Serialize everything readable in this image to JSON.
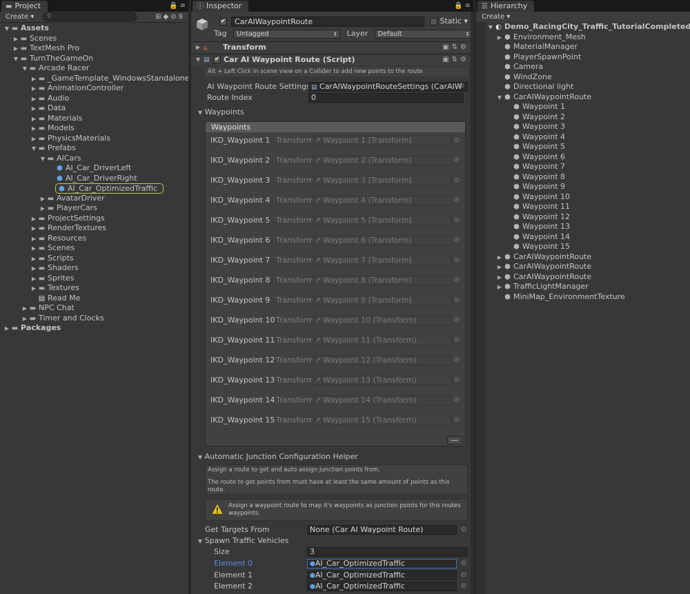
{
  "project": {
    "tab_label": "Project",
    "create_label": "Create",
    "hidden_count": "9",
    "tree": [
      {
        "label": "Assets",
        "depth": 0,
        "arrow": "▼",
        "icon": "folder",
        "bold": true
      },
      {
        "label": "Scenes",
        "depth": 1,
        "arrow": "▶",
        "icon": "folder"
      },
      {
        "label": "TextMesh Pro",
        "depth": 1,
        "arrow": "▶",
        "icon": "folder"
      },
      {
        "label": "TurnTheGameOn",
        "depth": 1,
        "arrow": "▼",
        "icon": "folder"
      },
      {
        "label": "Arcade Racer",
        "depth": 2,
        "arrow": "▼",
        "icon": "folder"
      },
      {
        "label": "_GameTemplate_WindowsStandalone",
        "depth": 3,
        "arrow": "▶",
        "icon": "folder"
      },
      {
        "label": "AnimationController",
        "depth": 3,
        "arrow": "▶",
        "icon": "folder"
      },
      {
        "label": "Audio",
        "depth": 3,
        "arrow": "▶",
        "icon": "folder"
      },
      {
        "label": "Data",
        "depth": 3,
        "arrow": "▶",
        "icon": "folder"
      },
      {
        "label": "Materials",
        "depth": 3,
        "arrow": "▶",
        "icon": "folder"
      },
      {
        "label": "Models",
        "depth": 3,
        "arrow": "▶",
        "icon": "folder"
      },
      {
        "label": "PhysicsMaterials",
        "depth": 3,
        "arrow": "▶",
        "icon": "folder"
      },
      {
        "label": "Prefabs",
        "depth": 3,
        "arrow": "▼",
        "icon": "folder"
      },
      {
        "label": "AICars",
        "depth": 4,
        "arrow": "▼",
        "icon": "folder"
      },
      {
        "label": "AI_Car_DriverLeft",
        "depth": 5,
        "arrow": "",
        "icon": "prefab"
      },
      {
        "label": "AI_Car_DriverRight",
        "depth": 5,
        "arrow": "",
        "icon": "prefab"
      },
      {
        "label": "AI_Car_OptimizedTraffic",
        "depth": 5,
        "arrow": "",
        "icon": "prefab",
        "highlight": true
      },
      {
        "label": "AvatarDriver",
        "depth": 4,
        "arrow": "▶",
        "icon": "folder"
      },
      {
        "label": "PlayerCars",
        "depth": 4,
        "arrow": "▶",
        "icon": "folder"
      },
      {
        "label": "ProjectSettings",
        "depth": 3,
        "arrow": "▶",
        "icon": "folder"
      },
      {
        "label": "RenderTextures",
        "depth": 3,
        "arrow": "▶",
        "icon": "folder"
      },
      {
        "label": "Resources",
        "depth": 3,
        "arrow": "▶",
        "icon": "folder"
      },
      {
        "label": "Scenes",
        "depth": 3,
        "arrow": "▶",
        "icon": "folder"
      },
      {
        "label": "Scripts",
        "depth": 3,
        "arrow": "▶",
        "icon": "folder"
      },
      {
        "label": "Shaders",
        "depth": 3,
        "arrow": "▶",
        "icon": "folder"
      },
      {
        "label": "Sprites",
        "depth": 3,
        "arrow": "▶",
        "icon": "folder"
      },
      {
        "label": "Textures",
        "depth": 3,
        "arrow": "▶",
        "icon": "folder"
      },
      {
        "label": "Read Me",
        "depth": 3,
        "arrow": "",
        "icon": "doc"
      },
      {
        "label": "NPC Chat",
        "depth": 2,
        "arrow": "▶",
        "icon": "folder"
      },
      {
        "label": "Timer and Clocks",
        "depth": 2,
        "arrow": "▶",
        "icon": "folder"
      },
      {
        "label": "Packages",
        "depth": 0,
        "arrow": "▶",
        "icon": "folder",
        "bold": true
      }
    ]
  },
  "inspector": {
    "tab_label": "Inspector",
    "object_name": "CarAIWaypointRoute",
    "static_label": "Static",
    "tag_label": "Tag",
    "tag_value": "Untagged",
    "layer_label": "Layer",
    "layer_value": "Default",
    "transform_label": "Transform",
    "script_label": "Car AI Waypoint Route (Script)",
    "hint_text": "Alt + Left Click in scene view on a Collider to add new points to the route",
    "settings_label": "AI Waypoint Route Settings",
    "settings_value": "CarAIWaypointRouteSettings (CarAIW",
    "route_index_label": "Route Index",
    "route_index_value": "0",
    "waypoints_foldout": "Waypoints",
    "waypoints_header": "Waypoints",
    "type_label": "Transform",
    "waypoints": [
      {
        "label": "IKD_Waypoint 1",
        "value": "Waypoint 1 (Transform)"
      },
      {
        "label": "IKD_Waypoint 2",
        "value": "Waypoint 2 (Transform)"
      },
      {
        "label": "IKD_Waypoint 3",
        "value": "Waypoint 3 (Transform)"
      },
      {
        "label": "IKD_Waypoint 4",
        "value": "Waypoint 4 (Transform)"
      },
      {
        "label": "IKD_Waypoint 5",
        "value": "Waypoint 5 (Transform)"
      },
      {
        "label": "IKD_Waypoint 6",
        "value": "Waypoint 6 (Transform)"
      },
      {
        "label": "IKD_Waypoint 7",
        "value": "Waypoint 7 (Transform)"
      },
      {
        "label": "IKD_Waypoint 8",
        "value": "Waypoint 8 (Transform)"
      },
      {
        "label": "IKD_Waypoint 9",
        "value": "Waypoint 9 (Transform)"
      },
      {
        "label": "IKD_Waypoint 10",
        "value": "Waypoint 10 (Transform)"
      },
      {
        "label": "IKD_Waypoint 11",
        "value": "Waypoint 11 (Transform)"
      },
      {
        "label": "IKD_Waypoint 12",
        "value": "Waypoint 12 (Transform)"
      },
      {
        "label": "IKD_Waypoint 13",
        "value": "Waypoint 13 (Transform)"
      },
      {
        "label": "IKD_Waypoint 14",
        "value": "Waypoint 14 (Transform)"
      },
      {
        "label": "IKD_Waypoint 15",
        "value": "Waypoint 15 (Transform)"
      }
    ],
    "minus_label": "—",
    "junction_foldout": "Automatic Junction Configuration Helper",
    "junction_help_1": "Assign a route to get and auto assign junction points from.",
    "junction_help_2": "The route to get points from must have at least the same amount of points as this route.",
    "warning_text": "Assign a waypoint route to map it's waypoints as junction points for this routes waypoints.",
    "get_targets_label": "Get Targets From",
    "get_targets_value": "None (Car AI Waypoint Route)",
    "spawn_foldout": "Spawn Traffic Vehicles",
    "size_label": "Size",
    "size_value": "3",
    "elements": [
      {
        "label": "Element 0",
        "value": "AI_Car_OptimizedTraffic"
      },
      {
        "label": "Element 1",
        "value": "AI_Car_OptimizedTraffic"
      },
      {
        "label": "Element 2",
        "value": "AI_Car_OptimizedTraffic"
      }
    ]
  },
  "hierarchy": {
    "tab_label": "Hierarchy",
    "create_label": "Create",
    "tree": [
      {
        "label": "Demo_RacingCity_Traffic_TutorialCompleted",
        "depth": 0,
        "arrow": "▼",
        "icon": "scene",
        "bold": true
      },
      {
        "label": "Environment_Mesh",
        "depth": 1,
        "arrow": "▶",
        "icon": "cube"
      },
      {
        "label": "MaterialManager",
        "depth": 1,
        "arrow": "",
        "icon": "cube"
      },
      {
        "label": "PlayerSpawnPoint",
        "depth": 1,
        "arrow": "",
        "icon": "cube"
      },
      {
        "label": "Camera",
        "depth": 1,
        "arrow": "",
        "icon": "cube"
      },
      {
        "label": "WindZone",
        "depth": 1,
        "arrow": "",
        "icon": "cube"
      },
      {
        "label": "Directional light",
        "depth": 1,
        "arrow": "",
        "icon": "cube"
      },
      {
        "label": "CarAIWaypointRoute",
        "depth": 1,
        "arrow": "▼",
        "icon": "cube"
      },
      {
        "label": "Waypoint 1",
        "depth": 2,
        "arrow": "",
        "icon": "cube"
      },
      {
        "label": "Waypoint 2",
        "depth": 2,
        "arrow": "",
        "icon": "cube"
      },
      {
        "label": "Waypoint 3",
        "depth": 2,
        "arrow": "",
        "icon": "cube"
      },
      {
        "label": "Waypoint 4",
        "depth": 2,
        "arrow": "",
        "icon": "cube"
      },
      {
        "label": "Waypoint 5",
        "depth": 2,
        "arrow": "",
        "icon": "cube"
      },
      {
        "label": "Waypoint 6",
        "depth": 2,
        "arrow": "",
        "icon": "cube"
      },
      {
        "label": "Waypoint 7",
        "depth": 2,
        "arrow": "",
        "icon": "cube"
      },
      {
        "label": "Waypoint 8",
        "depth": 2,
        "arrow": "",
        "icon": "cube"
      },
      {
        "label": "Waypoint 9",
        "depth": 2,
        "arrow": "",
        "icon": "cube"
      },
      {
        "label": "Waypoint 10",
        "depth": 2,
        "arrow": "",
        "icon": "cube"
      },
      {
        "label": "Waypoint 11",
        "depth": 2,
        "arrow": "",
        "icon": "cube"
      },
      {
        "label": "Waypoint 12",
        "depth": 2,
        "arrow": "",
        "icon": "cube"
      },
      {
        "label": "Waypoint 13",
        "depth": 2,
        "arrow": "",
        "icon": "cube"
      },
      {
        "label": "Waypoint 14",
        "depth": 2,
        "arrow": "",
        "icon": "cube"
      },
      {
        "label": "Waypoint 15",
        "depth": 2,
        "arrow": "",
        "icon": "cube"
      },
      {
        "label": "CarAIWaypointRoute",
        "depth": 1,
        "arrow": "▶",
        "icon": "cube"
      },
      {
        "label": "CarAIWaypointRoute",
        "depth": 1,
        "arrow": "▶",
        "icon": "cube"
      },
      {
        "label": "CarAIWaypointRoute",
        "depth": 1,
        "arrow": "▶",
        "icon": "cube"
      },
      {
        "label": "TrafficLightManager",
        "depth": 1,
        "arrow": "▶",
        "icon": "cube"
      },
      {
        "label": "MiniMap_EnvironmentTexture",
        "depth": 1,
        "arrow": "",
        "icon": "cube"
      }
    ]
  },
  "colors": {
    "highlight_border": "#c9c74a",
    "prefab_blue": "#5ea3e6",
    "selected_label": "#5b8be8"
  }
}
